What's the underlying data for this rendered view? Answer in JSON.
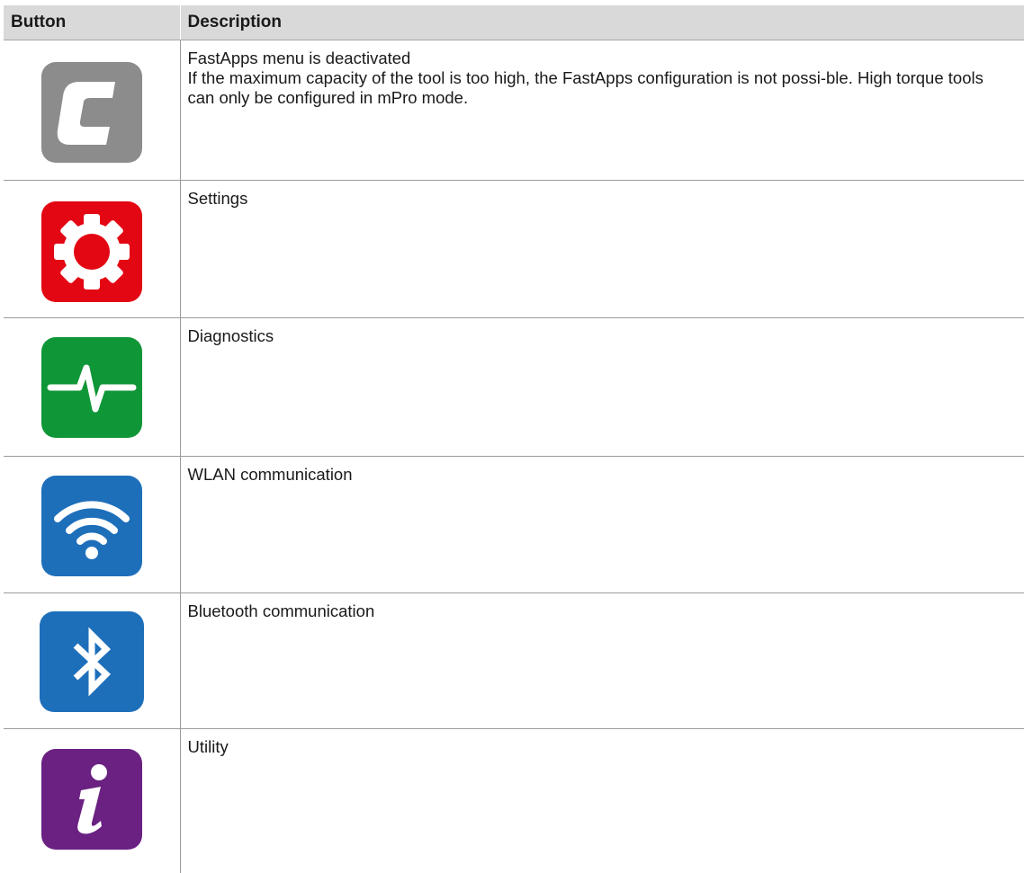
{
  "table": {
    "headers": {
      "button": "Button",
      "description": "Description"
    },
    "rows": [
      {
        "icon": "fastapps-c-icon",
        "color": "#8c8c8c",
        "title": "FastApps menu is deactivated",
        "body": "If the maximum capacity of the tool is too high, the FastApps configuration is not possi-ble. High torque tools can only be configured in mPro mode."
      },
      {
        "icon": "gear-icon",
        "color": "#e30613",
        "title": "Settings",
        "body": ""
      },
      {
        "icon": "pulse-icon",
        "color": "#0f9637",
        "title": "Diagnostics",
        "body": ""
      },
      {
        "icon": "wifi-icon",
        "color": "#1e6fba",
        "title": "WLAN communication",
        "body": ""
      },
      {
        "icon": "bluetooth-icon",
        "color": "#1e6fba",
        "title": "Bluetooth communication",
        "body": ""
      },
      {
        "icon": "info-icon",
        "color": "#6a2182",
        "title": "Utility",
        "body": ""
      }
    ]
  }
}
